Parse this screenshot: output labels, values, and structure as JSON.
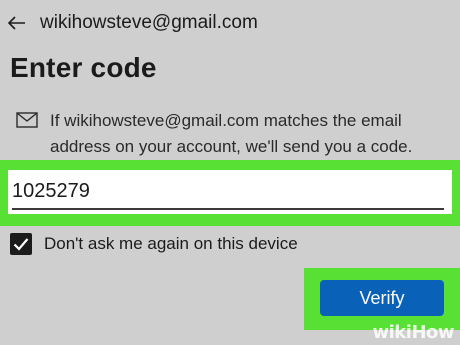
{
  "header": {
    "back_icon": "arrow-left-icon",
    "account_email": "wikihowsteve@gmail.com"
  },
  "title": "Enter code",
  "info": {
    "icon": "envelope-icon",
    "text": "If wikihowsteve@gmail.com matches the email address on your account, we'll send you a code."
  },
  "code_field": {
    "value": "1025279"
  },
  "remember": {
    "checked": true,
    "label": "Don't ask me again on this device"
  },
  "verify_button": {
    "label": "Verify"
  },
  "watermark": {
    "wiki": "wiki",
    "how": "How"
  },
  "colors": {
    "background": "#cfcfcf",
    "highlight": "#58e034",
    "button": "#0a62b8"
  }
}
